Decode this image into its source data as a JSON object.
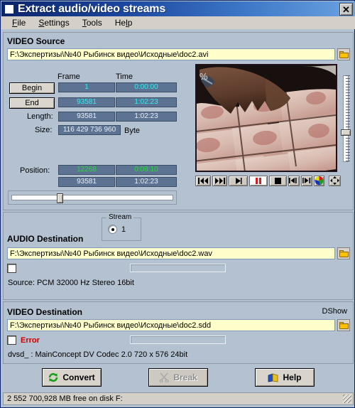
{
  "window": {
    "title": "Extract audio/video streams",
    "close_label": "✕",
    "icon": "app-icon"
  },
  "menu": [
    {
      "label": "File",
      "accel": "F"
    },
    {
      "label": "Settings",
      "accel": "S"
    },
    {
      "label": "Tools",
      "accel": "T"
    },
    {
      "label": "Help",
      "accel": "H"
    }
  ],
  "video_source": {
    "section_label": "VIDEO Source",
    "path": "F:\\Экспертизы\\№40 Рыбинск видео\\Исходные\\doc2.avi",
    "browse_icon": "folder-icon",
    "col_frame": "Frame",
    "col_time": "Time",
    "begin_button": "Begin",
    "end_button": "End",
    "begin_frame": "1",
    "begin_time": "0:00:00",
    "end_frame": "93581",
    "end_time": "1:02:23",
    "length_label": "Length:",
    "length_frame": "93581",
    "length_time": "1:02:23",
    "size_label": "Size:",
    "size_value": "116 429 736 960",
    "size_unit": "Byte",
    "position_label": "Position:",
    "position_frame": "12268",
    "position_time": "0:08:10",
    "total_frame": "93581",
    "total_time": "1:02:23"
  },
  "player": {
    "buttons": [
      {
        "name": "skip-to-begin-button",
        "icon": "skip-back-icon"
      },
      {
        "name": "skip-to-end-button",
        "icon": "skip-forward-icon"
      },
      {
        "name": "play-button",
        "icon": "play-icon"
      },
      {
        "name": "pause-button",
        "icon": "pause-icon"
      },
      {
        "name": "stop-button",
        "icon": "stop-icon"
      },
      {
        "name": "step-back-button",
        "icon": "step-back-icon"
      },
      {
        "name": "step-forward-button",
        "icon": "step-forward-icon"
      },
      {
        "name": "capture-frame-button",
        "icon": "color-wheel-icon"
      },
      {
        "name": "fullscreen-button",
        "icon": "expand-arrows-icon"
      }
    ]
  },
  "audio_destination": {
    "section_label": "AUDIO Destination",
    "stream_group_title": "Stream",
    "stream_value": "1",
    "path": "F:\\Экспертизы\\№40 Рыбинск видео\\Исходные\\doc2.wav",
    "browse_icon": "folder-icon",
    "source_info": "Source: PCM 32000 Hz Stereo  16bit"
  },
  "video_destination": {
    "section_label": "VIDEO Destination",
    "mode_label": "DShow",
    "path": "F:\\Экспертизы\\№40 Рыбинск видео\\Исходные\\doc2.sdd",
    "browse_icon": "folder-icon",
    "error_label": "Error",
    "codec_info": "dvsd_ : MainConcept DV Codec 2.0 720 x 576 24bit"
  },
  "actions": {
    "convert": "Convert",
    "convert_icon": "refresh-icon",
    "break": "Break",
    "break_icon": "scissors-icon",
    "help": "Help",
    "help_icon": "help-book-icon"
  },
  "status": {
    "text": "2 552 700,928 MB free on disk F:"
  },
  "colors": {
    "title_start": "#0a246a",
    "title_end": "#6ba2e0",
    "panel_bg": "#b3c1d1",
    "field_bg": "#ffffcc",
    "value_bg": "#5d7394",
    "cyan_text": "#2ff0f0",
    "green_text": "#22dd33",
    "error_text": "#cc0000"
  }
}
